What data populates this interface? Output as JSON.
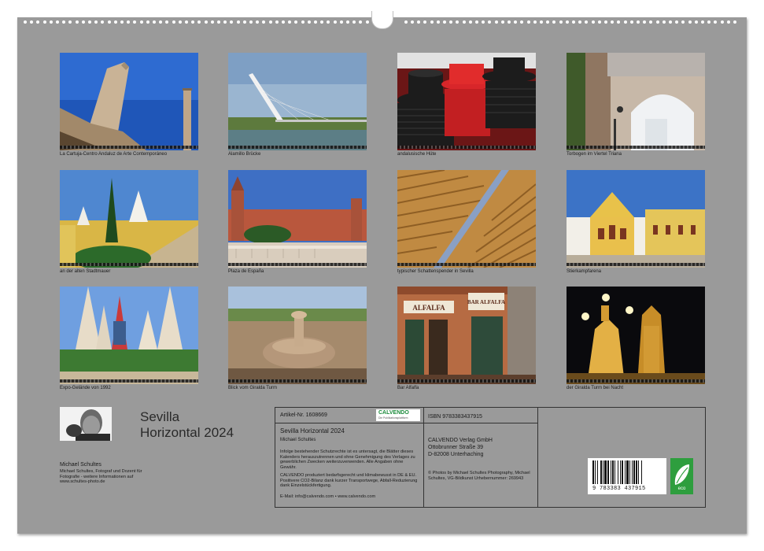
{
  "photos": [
    {
      "caption": "La Cartuja-Centro Andaluz de Arte Contemporáneo"
    },
    {
      "caption": "Alamillo Brücke"
    },
    {
      "caption": "andalusische Hüte"
    },
    {
      "caption": "Torbogen im Viertel Triana"
    },
    {
      "caption": "an der alten Stadtmauer"
    },
    {
      "caption": "Plaza de España"
    },
    {
      "caption": "typischer Schattenspender in Sevilla"
    },
    {
      "caption": "Stierkampfarena"
    },
    {
      "caption": "Expo-Gelände von 1992"
    },
    {
      "caption": "Blick vom Giralda Turm"
    },
    {
      "caption": "Bar Alfalfa",
      "sign_left": "ALFALFA",
      "sign_right": "BAR ALFALFA"
    },
    {
      "caption": "der Giralda Turm bei Nacht"
    }
  ],
  "author": {
    "title_line1": "Sevilla",
    "title_line2": "Horizontal 2024",
    "name": "Michael Schultes",
    "bio": "Michael Schultes, Fotograf und Dozent für Fotografie - weitere Informationen auf www.schultes-photo.de"
  },
  "info": {
    "article_label": "Artikel-Nr. 1608669",
    "brand_name": "CALVENDO",
    "brand_sub": "Die Publikationsplattform",
    "isbn": "ISBN 9783383437915",
    "product_title": "Sevilla Horizontal 2024",
    "product_author": "Michael Schultes",
    "legal_text": "Infolge bestehender Schutzrechte ist es untersagt, die Blätter dieses Kalenders herauszutrennen und ohne Genehmigung des Verlages zu gewerblichen Zwecken weiterzuverwenden. Alle Angaben ohne Gewähr.",
    "eco_text": "CALVENDO produziert bedarfsgerecht und klimabewusst in DE & EU. Positivere CO2-Bilanz dank kurzer Transportwege, Abfall-Reduzierung dank Einzelstückfertigung.",
    "contact": "E-Mail: info@calvendo.com • www.calvendo.com",
    "publisher": "CALVENDO Verlag GmbH",
    "street": "Ottobrunner Straße 39",
    "city": "D-82008 Unterhaching",
    "copyright": "© Photos by Michael Schultes Photography, Michael Schultes, VG-Bildkunst Urheber­nummer: 269943",
    "barcode_digits": "9 783383 437915",
    "eco_label": "eco"
  },
  "colors": {
    "sheet": "#9a9a9a",
    "eco_green": "#2e9e3e"
  }
}
